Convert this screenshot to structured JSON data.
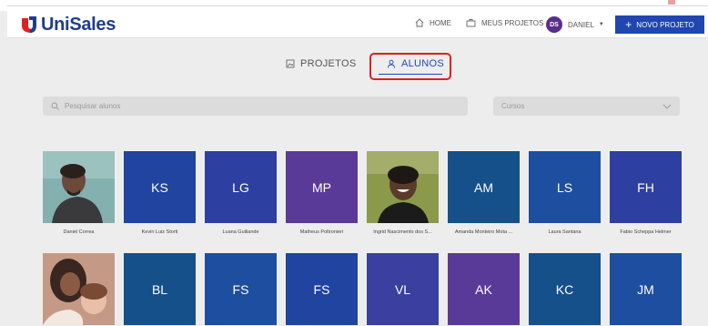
{
  "brand": {
    "name": "UniSales",
    "color": "#1f3d8a",
    "accent": "#e02020"
  },
  "nav": {
    "home": "HOME",
    "projects": "MEUS PROJETOS",
    "user_initials": "DS",
    "user_name": "DANIEL",
    "new_project": "NOVO PROJETO"
  },
  "tabs": [
    {
      "label": "PROJETOS",
      "icon": "image-icon",
      "active": false
    },
    {
      "label": "ALUNOS",
      "icon": "user-icon",
      "active": true
    }
  ],
  "search": {
    "placeholder": "Pesquisar alunos"
  },
  "filter": {
    "placeholder": "Cursos"
  },
  "students": [
    {
      "name": "Daniel Correa",
      "initials": "",
      "photo": true,
      "color": "#7fa9a9"
    },
    {
      "name": "Kevin Luiz Storti",
      "initials": "KS",
      "photo": false,
      "color": "#20449f"
    },
    {
      "name": "Luana Guiliande",
      "initials": "LG",
      "photo": false,
      "color": "#2d3fa0"
    },
    {
      "name": "Matheus Poltronieri",
      "initials": "MP",
      "photo": false,
      "color": "#5a3a98"
    },
    {
      "name": "Ingrid Nascimento dos S...",
      "initials": "",
      "photo": true,
      "color": "#6b7a3a"
    },
    {
      "name": "Amanda Monteiro Mota ...",
      "initials": "AM",
      "photo": false,
      "color": "#15508a"
    },
    {
      "name": "Laura Santana",
      "initials": "LS",
      "photo": false,
      "color": "#1e4ea0"
    },
    {
      "name": "Fabio Scheppa Helmer",
      "initials": "FH",
      "photo": false,
      "color": "#2d3fa0"
    },
    {
      "name": "",
      "initials": "",
      "photo": true,
      "color": "#b08070"
    },
    {
      "name": "",
      "initials": "BL",
      "photo": false,
      "color": "#15508a"
    },
    {
      "name": "",
      "initials": "FS",
      "photo": false,
      "color": "#1e4ea0"
    },
    {
      "name": "",
      "initials": "FS",
      "photo": false,
      "color": "#20449f"
    },
    {
      "name": "",
      "initials": "VL",
      "photo": false,
      "color": "#3a3fa0"
    },
    {
      "name": "",
      "initials": "AK",
      "photo": false,
      "color": "#5a3a98"
    },
    {
      "name": "",
      "initials": "KC",
      "photo": false,
      "color": "#15508a"
    },
    {
      "name": "",
      "initials": "JM",
      "photo": false,
      "color": "#1e4ea0"
    }
  ]
}
